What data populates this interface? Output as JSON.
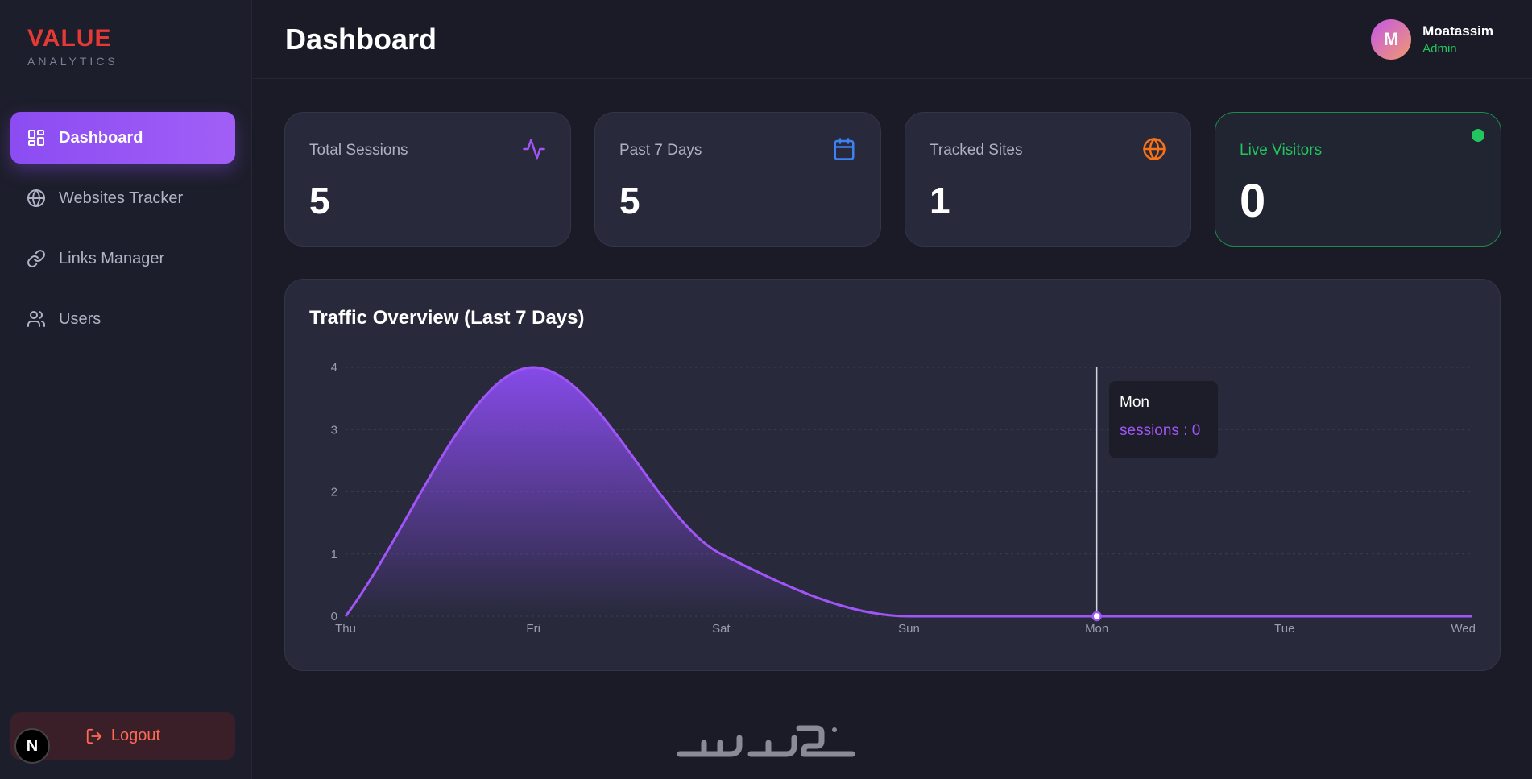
{
  "brand": {
    "name": "VALUE",
    "sub": "ANALYTICS"
  },
  "sidebar": {
    "items": [
      {
        "label": "Dashboard",
        "icon": "dashboard-grid-icon",
        "active": true
      },
      {
        "label": "Websites Tracker",
        "icon": "globe-icon",
        "active": false
      },
      {
        "label": "Links Manager",
        "icon": "link-icon",
        "active": false
      },
      {
        "label": "Users",
        "icon": "users-icon",
        "active": false
      }
    ],
    "logout_label": "Logout",
    "badge_letter": "N"
  },
  "header": {
    "title": "Dashboard",
    "user": {
      "initial": "M",
      "name": "Moatassim",
      "role": "Admin"
    }
  },
  "stats": [
    {
      "label": "Total Sessions",
      "value": "5",
      "icon": "activity-pulse-icon",
      "color": "#a155f7"
    },
    {
      "label": "Past 7 Days",
      "value": "5",
      "icon": "calendar-icon",
      "color": "#3b82f6"
    },
    {
      "label": "Tracked Sites",
      "value": "1",
      "icon": "globe-icon",
      "color": "#f97316"
    },
    {
      "label": "Live Visitors",
      "value": "0",
      "icon": "live-dot",
      "color": "#22c55e"
    }
  ],
  "chart": {
    "title": "Traffic Overview (Last 7 Days)",
    "tooltip": {
      "title": "Mon",
      "text": "sessions : 0"
    }
  },
  "chart_data": {
    "type": "area",
    "categories": [
      "Thu",
      "Fri",
      "Sat",
      "Sun",
      "Mon",
      "Tue",
      "Wed"
    ],
    "series": [
      {
        "name": "sessions",
        "values": [
          0,
          4,
          1,
          0,
          0,
          0,
          0
        ]
      }
    ],
    "ylim": [
      0,
      4
    ],
    "yticks": [
      "0",
      "1",
      "2",
      "3",
      "4"
    ],
    "grid": true,
    "color": "#a155f7",
    "highlight_index": 4
  },
  "colors": {
    "accent": "#8b4cf2",
    "brand": "#e53935",
    "success": "#22c55e",
    "danger": "#ff6a55"
  }
}
